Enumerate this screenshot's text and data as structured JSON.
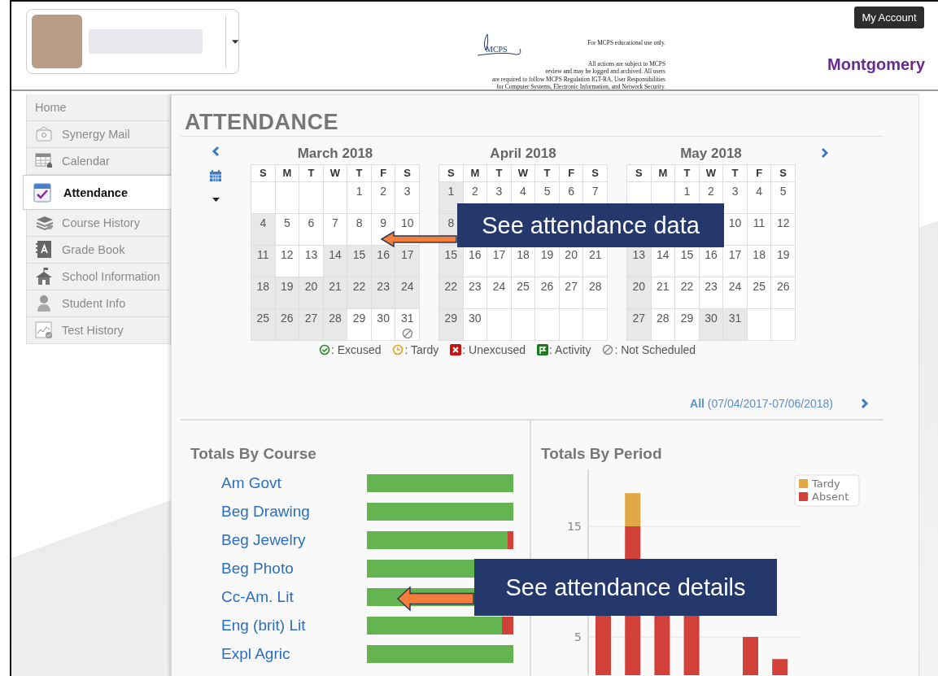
{
  "header": {
    "logo_text": "MCPS",
    "notice_lines": [
      "For MCPS educational use only.",
      "All actions are subject to MCPS",
      "review and may be logged and archived. All users",
      "are required to follow MCPS Regulation IGT-RA, User Responsibilities",
      "for Computer Systems,  Electronic Information, and Network Security."
    ],
    "account_button": "My Account",
    "district_name": "Montgomery"
  },
  "sidebar": {
    "items": [
      {
        "label": "Home",
        "selected": false
      },
      {
        "label": "Synergy Mail",
        "selected": false
      },
      {
        "label": "Calendar",
        "selected": false
      },
      {
        "label": "Attendance",
        "selected": true
      },
      {
        "label": "Course History",
        "selected": false
      },
      {
        "label": "Grade Book",
        "selected": false
      },
      {
        "label": "School Information",
        "selected": false
      },
      {
        "label": "Student Info",
        "selected": false
      },
      {
        "label": "Test History",
        "selected": false
      }
    ]
  },
  "page_title": "ATTENDANCE",
  "calendar": {
    "months": [
      {
        "title": "March 2018",
        "weekdays": [
          "S",
          "M",
          "T",
          "W",
          "T",
          "F",
          "S"
        ],
        "weeks": [
          {
            "kind": "head",
            "cells": [
              {
                "day": "1",
                "shaded": false
              },
              {
                "day": "2",
                "shaded": false
              },
              {
                "day": "3",
                "shaded": false
              }
            ]
          },
          {
            "kind": "body",
            "cells": [
              {
                "day": "4",
                "shaded": true
              },
              {
                "day": "5",
                "shaded": false
              },
              {
                "day": "6",
                "shaded": false
              },
              {
                "day": "7",
                "shaded": false
              },
              {
                "day": "8",
                "shaded": false
              },
              {
                "day": "9",
                "shaded": false
              },
              {
                "day": "10",
                "shaded": false
              }
            ]
          },
          {
            "kind": "body",
            "cells": [
              {
                "day": "11",
                "shaded": true
              },
              {
                "day": "12",
                "shaded": false
              },
              {
                "day": "13",
                "shaded": false
              },
              {
                "day": "14",
                "shaded": true
              },
              {
                "day": "15",
                "shaded": true
              },
              {
                "day": "16",
                "shaded": true
              },
              {
                "day": "17",
                "shaded": true
              }
            ]
          },
          {
            "kind": "body",
            "cells": [
              {
                "day": "18",
                "shaded": true
              },
              {
                "day": "19",
                "shaded": true
              },
              {
                "day": "20",
                "shaded": true
              },
              {
                "day": "21",
                "shaded": true
              },
              {
                "day": "22",
                "shaded": true
              },
              {
                "day": "23",
                "shaded": true
              },
              {
                "day": "24",
                "shaded": true
              }
            ]
          },
          {
            "kind": "body",
            "cells": [
              {
                "day": "25",
                "shaded": true
              },
              {
                "day": "26",
                "shaded": true
              },
              {
                "day": "27",
                "shaded": true
              },
              {
                "day": "28",
                "shaded": true
              },
              {
                "day": "29",
                "shaded": false
              },
              {
                "day": "30",
                "shaded": false
              },
              {
                "day": "31",
                "shaded": false,
                "kind": "not_scheduled"
              }
            ]
          }
        ]
      },
      {
        "title": "April 2018",
        "weekdays": [
          "S",
          "M",
          "T",
          "W",
          "T",
          "F",
          "S"
        ],
        "weeks": [
          {
            "kind": "body",
            "cells": [
              {
                "day": "1",
                "shaded": true
              },
              {
                "day": "2",
                "shaded": false
              },
              {
                "day": "3",
                "shaded": false
              },
              {
                "day": "4",
                "shaded": false
              },
              {
                "day": "5",
                "shaded": false
              },
              {
                "day": "6",
                "shaded": false
              },
              {
                "day": "7",
                "shaded": false
              }
            ]
          },
          {
            "kind": "coveredbody",
            "cells": [
              {
                "day": "8",
                "shaded": true
              }
            ]
          },
          {
            "kind": "body",
            "cells": [
              {
                "day": "15",
                "shaded": true
              },
              {
                "day": "16",
                "shaded": false
              },
              {
                "day": "17",
                "shaded": false
              },
              {
                "day": "18",
                "shaded": false
              },
              {
                "day": "19",
                "shaded": false
              },
              {
                "day": "20",
                "shaded": false
              },
              {
                "day": "21",
                "shaded": false
              }
            ]
          },
          {
            "kind": "body",
            "cells": [
              {
                "day": "22",
                "shaded": true
              },
              {
                "day": "23",
                "shaded": false
              },
              {
                "day": "24",
                "shaded": false
              },
              {
                "day": "25",
                "shaded": false
              },
              {
                "day": "26",
                "shaded": false
              },
              {
                "day": "27",
                "shaded": false
              },
              {
                "day": "28",
                "shaded": false
              }
            ]
          },
          {
            "kind": "body",
            "cells": [
              {
                "day": "29",
                "shaded": true
              },
              {
                "day": "30",
                "shaded": false
              }
            ]
          }
        ]
      },
      {
        "title": "May 2018",
        "weekdays": [
          "S",
          "M",
          "T",
          "W",
          "T",
          "F",
          "S"
        ],
        "weeks": [
          {
            "kind": "head",
            "cells": [
              {
                "day": "1",
                "shaded": false
              },
              {
                "day": "2",
                "shaded": false
              },
              {
                "day": "3",
                "shaded": false
              },
              {
                "day": "4",
                "shaded": false
              },
              {
                "day": "5",
                "shaded": false
              }
            ]
          },
          {
            "kind": "coveredhead",
            "cells": [
              {
                "day": "10",
                "shaded": false
              },
              {
                "day": "11",
                "shaded": false
              },
              {
                "day": "12",
                "shaded": false
              }
            ]
          },
          {
            "kind": "body",
            "cells": [
              {
                "day": "13",
                "shaded": true
              },
              {
                "day": "14",
                "shaded": false
              },
              {
                "day": "15",
                "shaded": false
              },
              {
                "day": "16",
                "shaded": false
              },
              {
                "day": "17",
                "shaded": false
              },
              {
                "day": "18",
                "shaded": false
              },
              {
                "day": "19",
                "shaded": false
              }
            ]
          },
          {
            "kind": "body",
            "cells": [
              {
                "day": "20",
                "shaded": true
              },
              {
                "day": "21",
                "shaded": false
              },
              {
                "day": "22",
                "shaded": false
              },
              {
                "day": "23",
                "shaded": false
              },
              {
                "day": "24",
                "shaded": false
              },
              {
                "day": "25",
                "shaded": false
              },
              {
                "day": "26",
                "shaded": false
              }
            ]
          },
          {
            "kind": "body",
            "cells": [
              {
                "day": "27",
                "shaded": true
              },
              {
                "day": "28",
                "shaded": false
              },
              {
                "day": "29",
                "shaded": false
              },
              {
                "day": "30",
                "shaded": true
              },
              {
                "day": "31",
                "shaded": true
              }
            ]
          }
        ]
      }
    ],
    "legend": [
      {
        "kind": "excused",
        "label": ": Excused"
      },
      {
        "kind": "tardy",
        "label": ": Tardy"
      },
      {
        "kind": "unexcused",
        "label": ": Unexcused"
      },
      {
        "kind": "activity",
        "label": ": Activity"
      },
      {
        "kind": "not_scheduled",
        "label": ": Not Scheduled"
      }
    ],
    "range_label": "All",
    "range_dates": "(07/04/2017-07/06/2018)"
  },
  "totals_by_course": {
    "title": "Totals By Course",
    "courses": [
      {
        "name": "Am Govt",
        "level": 1
      },
      {
        "name": "Beg Drawing",
        "level": 1
      },
      {
        "name": "Beg Jewelry",
        "level": 0.96
      },
      {
        "name": "Beg Photo",
        "level": 1
      },
      {
        "name": "Cc-Am. Lit",
        "level": 1
      },
      {
        "name": "Eng (brit) Lit",
        "level": 0.92
      },
      {
        "name": "Expl Agric",
        "level": 1
      }
    ]
  },
  "totals_by_period": {
    "title": "Totals By Period",
    "axis_labels": [
      "15",
      "5"
    ],
    "legend": [
      {
        "label": "Tardy",
        "color": "#e2a845"
      },
      {
        "label": "Absent",
        "color": "#d2403a"
      }
    ]
  },
  "callouts": [
    {
      "text": "See attendance data"
    },
    {
      "text": "See attendance details"
    }
  ]
}
